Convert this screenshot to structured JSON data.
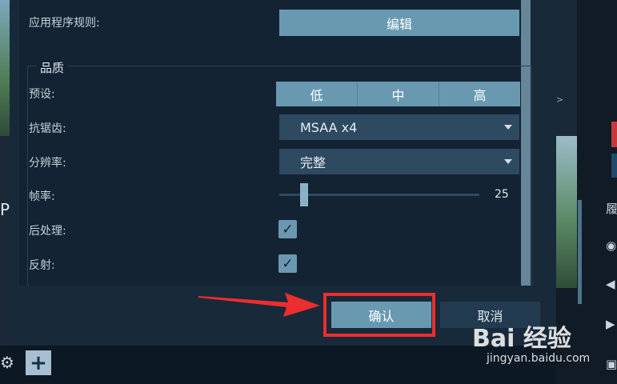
{
  "settings": {
    "app_rules_label": "应用程序规则:",
    "edit_button": "编辑",
    "quality_group_title": "品质",
    "preset_label": "预设:",
    "preset_options": [
      "低",
      "中",
      "高"
    ],
    "antialias_label": "抗锯齿:",
    "antialias_value": "MSAA x4",
    "resolution_label": "分辨率:",
    "resolution_value": "完整",
    "framerate_label": "帧率:",
    "framerate_value": "25",
    "postprocess_label": "后处理:",
    "postprocess_checked": true,
    "reflection_label": "反射:",
    "reflection_checked": true
  },
  "footer": {
    "confirm_button": "确认",
    "cancel_button": "取消"
  },
  "background": {
    "left_letter": "P",
    "right_char": "履"
  },
  "watermark": {
    "brand": "Bai 经验",
    "url": "jingyan.baidu.com"
  },
  "colors": {
    "accent": "#6999b1",
    "highlight": "#ec2e2e",
    "panel": "#18293a"
  }
}
